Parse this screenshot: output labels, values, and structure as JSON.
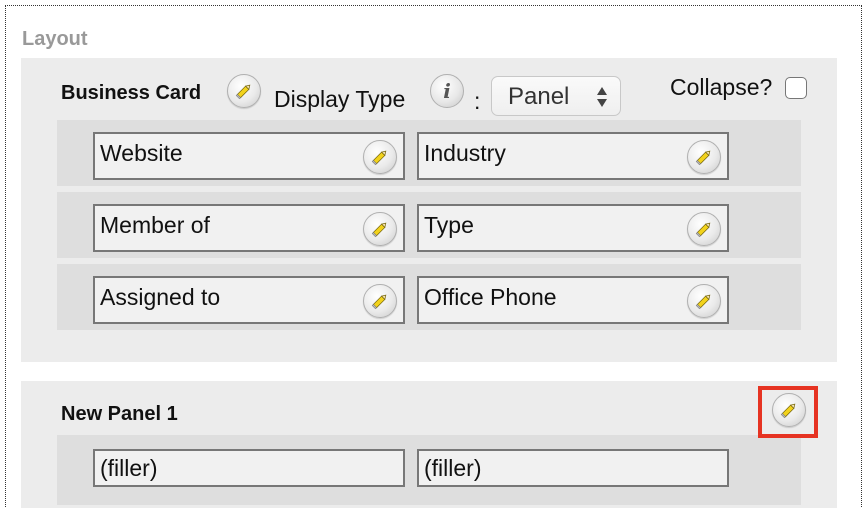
{
  "layout": {
    "title": "Layout"
  },
  "panels": [
    {
      "title": "Business Card",
      "display_type_label": "Display Type",
      "colon": ":",
      "display_type_value": "Panel",
      "collapse_label": "Collapse?",
      "collapse_checked": false,
      "rows": [
        [
          "Website",
          "Industry"
        ],
        [
          "Member of",
          "Type"
        ],
        [
          "Assigned to",
          "Office Phone"
        ]
      ]
    },
    {
      "title": "New Panel 1",
      "rows": [
        [
          "(filler)",
          "(filler)"
        ]
      ]
    }
  ],
  "icons": {
    "pencil": "pencil-icon",
    "info": "info-icon",
    "info_glyph": "i",
    "select_arrows": "updown-arrows-icon"
  },
  "colors": {
    "highlight": "#e63322",
    "pencil_yellow": "#f2d21b"
  }
}
